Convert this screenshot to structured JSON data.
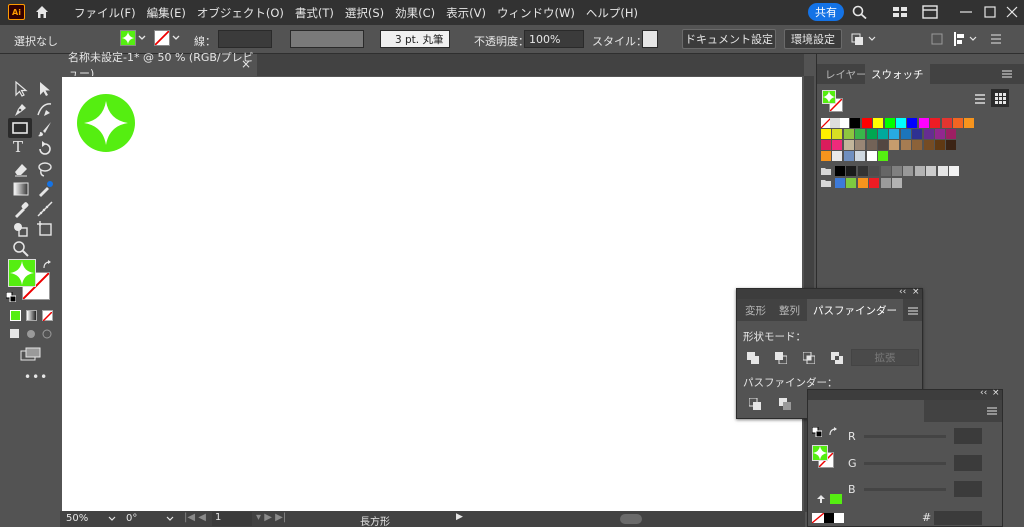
{
  "menubar": {
    "app_logo": "Ai",
    "items": [
      "ファイル(F)",
      "編集(E)",
      "オブジェクト(O)",
      "書式(T)",
      "選択(S)",
      "効果(C)",
      "表示(V)",
      "ウィンドウ(W)",
      "ヘルプ(H)"
    ],
    "share_label": "共有"
  },
  "controlbar": {
    "selection": "選択なし",
    "stroke_label": "線：",
    "stroke_profile": "3 pt. 丸筆",
    "opacity_label": "不透明度：",
    "opacity_value": "100%",
    "style_label": "スタイル：",
    "document_setup": "ドキュメント設定",
    "preferences": "環境設定"
  },
  "document": {
    "tab_title": "名称未設定-1* @ 50 % (RGB/プレビュー)",
    "close": "×"
  },
  "statusbar": {
    "zoom": "50%",
    "rotation": "0°",
    "artboard": "1",
    "tool": "長方形"
  },
  "panels": {
    "top_tabs": [
      "レイヤー",
      "スウォッチ"
    ],
    "pathfinder_tabs": [
      "変形",
      "整列",
      "パスファインダー"
    ],
    "shape_modes_label": "形状モード：",
    "expand_button": "拡張",
    "pathfinders_label": "パスファインダー：",
    "color_channels": [
      "R",
      "G",
      "B"
    ],
    "hex_symbol": "#"
  },
  "colors": {
    "accent_green": "#55ee11",
    "brand_orange": "#ff9a00",
    "share_blue": "#1473e6",
    "swatches_row1": [
      "#ffffff",
      "#000000",
      "#ff0000",
      "#ffff00",
      "#00ff00",
      "#00ffff",
      "#0000ff",
      "#ff00ff",
      "#ed1c24",
      "#e33530",
      "#f26522",
      "#f7941d"
    ],
    "swatches_row2": [
      "#fff200",
      "#d7df23",
      "#8dc63f",
      "#39b54a",
      "#00a651",
      "#00a99d",
      "#27aae1",
      "#1c75bc",
      "#2e3192",
      "#662d91",
      "#92278f",
      "#9e1f63"
    ],
    "swatches_row3": [
      "#da1c5c",
      "#ee2a7b",
      "#c2b59b",
      "#998675",
      "#736357",
      "#534741",
      "#c69c6d",
      "#a67c52",
      "#8c6239",
      "#754c24",
      "#603913",
      "#3c2415"
    ],
    "swatches_grays": [
      "#000000",
      "#1a1a1a",
      "#333333",
      "#4d4d4d",
      "#666666",
      "#808080",
      "#999999",
      "#b3b3b3",
      "#cccccc",
      "#e6e6e6",
      "#f2f2f2"
    ],
    "swatches_last": [
      "#3d7ad8",
      "#7ec940",
      "#f7941d",
      "#ed1c24",
      "#9b9b9b",
      "#b2b2b2"
    ]
  }
}
